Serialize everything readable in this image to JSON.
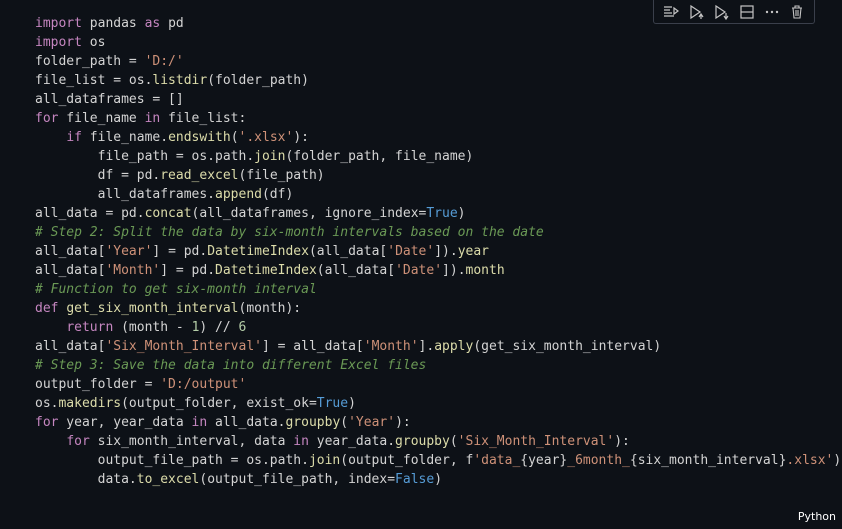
{
  "toolbar": {
    "buttons": [
      "run-by-line-icon",
      "execute-above-icon",
      "execute-below-icon",
      "split-cell-icon",
      "more-icon",
      "delete-icon"
    ]
  },
  "language": "Python",
  "code_lines": [
    [
      [
        "kw",
        "import"
      ],
      [
        "plain",
        " pandas "
      ],
      [
        "kw",
        "as"
      ],
      [
        "plain",
        " pd"
      ]
    ],
    [
      [
        "kw",
        "import"
      ],
      [
        "plain",
        " os"
      ]
    ],
    [
      [
        "plain",
        "folder_path = "
      ],
      [
        "str",
        "'D:/'"
      ]
    ],
    [
      [
        "plain",
        "file_list = os."
      ],
      [
        "fn",
        "listdir"
      ],
      [
        "plain",
        "("
      ],
      [
        "plain",
        "folder_path"
      ],
      [
        "plain",
        ")"
      ]
    ],
    [
      [
        "plain",
        "all_dataframes = []"
      ]
    ],
    [
      [
        "kw",
        "for"
      ],
      [
        "plain",
        " file_name "
      ],
      [
        "kw",
        "in"
      ],
      [
        "plain",
        " file_list:"
      ]
    ],
    [
      [
        "plain",
        "    "
      ],
      [
        "kw",
        "if"
      ],
      [
        "plain",
        " file_name."
      ],
      [
        "fn",
        "endswith"
      ],
      [
        "plain",
        "("
      ],
      [
        "str",
        "'.xlsx'"
      ],
      [
        "plain",
        "):"
      ]
    ],
    [
      [
        "plain",
        "        file_path = os.path."
      ],
      [
        "fn",
        "join"
      ],
      [
        "plain",
        "(folder_path, file_name)"
      ]
    ],
    [
      [
        "plain",
        "        df = pd."
      ],
      [
        "fn",
        "read_excel"
      ],
      [
        "plain",
        "(file_path)"
      ]
    ],
    [
      [
        "plain",
        "        all_dataframes."
      ],
      [
        "fn",
        "append"
      ],
      [
        "plain",
        "(df)"
      ]
    ],
    [
      [
        "plain",
        "all_data = pd."
      ],
      [
        "fn",
        "concat"
      ],
      [
        "plain",
        "(all_dataframes, ignore_index="
      ],
      [
        "const",
        "True"
      ],
      [
        "plain",
        ")"
      ]
    ],
    [
      [
        "cm",
        "# Step 2: Split the data by six-month intervals based on the date"
      ]
    ],
    [
      [
        "plain",
        "all_data["
      ],
      [
        "str",
        "'Year'"
      ],
      [
        "plain",
        "] = pd."
      ],
      [
        "fn",
        "DatetimeIndex"
      ],
      [
        "plain",
        "(all_data["
      ],
      [
        "str",
        "'Date'"
      ],
      [
        "plain",
        "])."
      ],
      [
        "fn",
        "year"
      ]
    ],
    [
      [
        "plain",
        "all_data["
      ],
      [
        "str",
        "'Month'"
      ],
      [
        "plain",
        "] = pd."
      ],
      [
        "fn",
        "DatetimeIndex"
      ],
      [
        "plain",
        "(all_data["
      ],
      [
        "str",
        "'Date'"
      ],
      [
        "plain",
        "])."
      ],
      [
        "fn",
        "month"
      ]
    ],
    [
      [
        "cm",
        "# Function to get six-month interval"
      ]
    ],
    [
      [
        "kw",
        "def"
      ],
      [
        "plain",
        " "
      ],
      [
        "fn",
        "get_six_month_interval"
      ],
      [
        "plain",
        "(month):"
      ]
    ],
    [
      [
        "plain",
        "    "
      ],
      [
        "kw",
        "return"
      ],
      [
        "plain",
        " (month - "
      ],
      [
        "num",
        "1"
      ],
      [
        "plain",
        ") // "
      ],
      [
        "num",
        "6"
      ]
    ],
    [
      [
        "plain",
        "all_data["
      ],
      [
        "str",
        "'Six_Month_Interval'"
      ],
      [
        "plain",
        "] = all_data["
      ],
      [
        "str",
        "'Month'"
      ],
      [
        "plain",
        "]."
      ],
      [
        "fn",
        "apply"
      ],
      [
        "plain",
        "(get_six_month_interval)"
      ]
    ],
    [
      [
        "cm",
        "# Step 3: Save the data into different Excel files"
      ]
    ],
    [
      [
        "plain",
        "output_folder = "
      ],
      [
        "str",
        "'D:/output'"
      ]
    ],
    [
      [
        "plain",
        "os."
      ],
      [
        "fn",
        "makedirs"
      ],
      [
        "plain",
        "(output_folder, exist_ok="
      ],
      [
        "const",
        "True"
      ],
      [
        "plain",
        ")"
      ]
    ],
    [
      [
        "kw",
        "for"
      ],
      [
        "plain",
        " year, year_data "
      ],
      [
        "kw",
        "in"
      ],
      [
        "plain",
        " all_data."
      ],
      [
        "fn",
        "groupby"
      ],
      [
        "plain",
        "("
      ],
      [
        "str",
        "'Year'"
      ],
      [
        "plain",
        "):"
      ]
    ],
    [
      [
        "plain",
        "    "
      ],
      [
        "kw",
        "for"
      ],
      [
        "plain",
        " six_month_interval, data "
      ],
      [
        "kw",
        "in"
      ],
      [
        "plain",
        " year_data."
      ],
      [
        "fn",
        "groupby"
      ],
      [
        "plain",
        "("
      ],
      [
        "str",
        "'Six_Month_Interval'"
      ],
      [
        "plain",
        "):"
      ]
    ],
    [
      [
        "plain",
        "        output_file_path = os.path."
      ],
      [
        "fn",
        "join"
      ],
      [
        "plain",
        "(output_folder, f"
      ],
      [
        "str",
        "'data_"
      ],
      [
        "plain",
        "{year}"
      ],
      [
        "str",
        "_6month_"
      ],
      [
        "plain",
        "{six_month_interval}"
      ],
      [
        "str",
        ".xlsx'"
      ],
      [
        "plain",
        ")"
      ]
    ],
    [
      [
        "plain",
        "        data."
      ],
      [
        "fn",
        "to_excel"
      ],
      [
        "plain",
        "(output_file_path, index="
      ],
      [
        "const",
        "False"
      ],
      [
        "plain",
        ")"
      ]
    ]
  ]
}
